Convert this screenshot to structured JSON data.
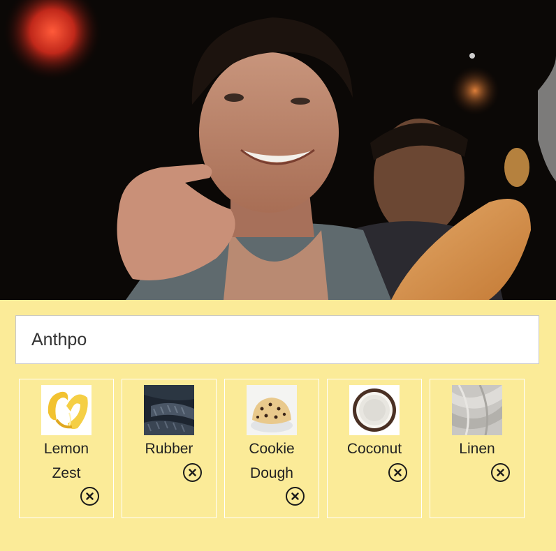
{
  "search": {
    "value": "Anthpo"
  },
  "photo": {
    "icon": "photo-image"
  },
  "scents": [
    {
      "label_line1": "Lemon",
      "label_line2": "Zest",
      "icon": "lemon-zest-thumbnail",
      "remove_icon": "close-circle-icon"
    },
    {
      "label_line1": "Rubber",
      "label_line2": "",
      "icon": "rubber-thumbnail",
      "remove_icon": "close-circle-icon"
    },
    {
      "label_line1": "Cookie",
      "label_line2": "Dough",
      "icon": "cookie-dough-thumbnail",
      "remove_icon": "close-circle-icon"
    },
    {
      "label_line1": "Coconut",
      "label_line2": "",
      "icon": "coconut-thumbnail",
      "remove_icon": "close-circle-icon"
    },
    {
      "label_line1": "Linen",
      "label_line2": "",
      "icon": "linen-thumbnail",
      "remove_icon": "close-circle-icon"
    }
  ],
  "colors": {
    "panel_background": "#fbeb98",
    "card_border": "#ffffff",
    "input_border": "#c8c8c8"
  }
}
